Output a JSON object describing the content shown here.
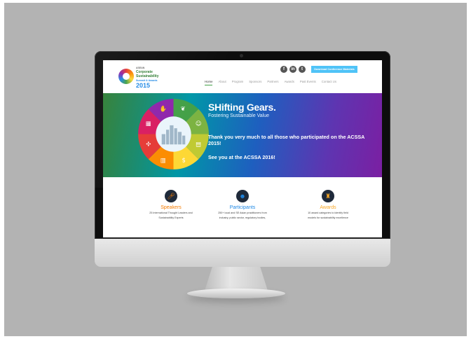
{
  "site": {
    "logo_lines": [
      "ASEAN",
      "Corporate",
      "Sustainability",
      "Summit & Awards",
      "2015"
    ],
    "download_button": "Download Conference Materials",
    "social": [
      "f",
      "in",
      "t"
    ],
    "nav": [
      "Home",
      "About",
      "Program",
      "Sponsors",
      "Partners",
      "Awards",
      "Past Events",
      "Contact Us"
    ],
    "hero": {
      "title": "SHifting Gears.",
      "subtitle": "Fostering Sustainable Value",
      "message": "Thank you very much to all those who participated on the ACSSA 2015!",
      "message2": "See you at the ACSSA 2016!"
    },
    "features": [
      {
        "title": "Speakers",
        "icon": "microphone-icon",
        "color": "#f57c00",
        "desc1": "25 International Thought Leaders and",
        "desc2": "Sustainability Experts"
      },
      {
        "title": "Participants",
        "icon": "people-icon",
        "color": "#1e88e5",
        "desc1": "250+ local and SE Asian practitioners from",
        "desc2": "industry, public sector, regulatory bodies,"
      },
      {
        "title": "Awards",
        "icon": "trophy-icon",
        "color": "#f9a825",
        "desc1": "10 award categories to identify field",
        "desc2": "models for sustainability excellence"
      }
    ]
  }
}
